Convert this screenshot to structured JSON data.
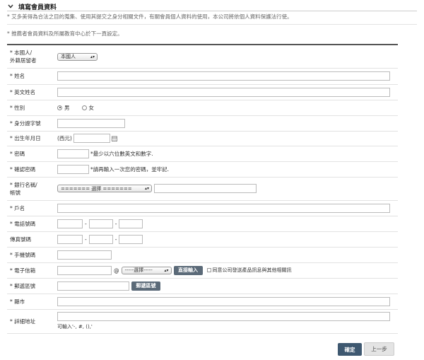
{
  "section": {
    "title": "填寫會員資料",
    "note1": "* 艾多美得為合法之目的蒐集、使用其提交之身分相關文件，有關會員個人資料的使用，本公司將依個人資料保護法行使。",
    "note2": "* 推薦者會員資料及所屬教育中心於下一頁設定。"
  },
  "form": {
    "resident": {
      "label_line1": "* 本國人/",
      "label_line2": "外籍居留者",
      "selected": "本國人"
    },
    "name": {
      "label": "* 姓名"
    },
    "english_name": {
      "label": "* 英文姓名"
    },
    "gender": {
      "label": "* 性別",
      "male": "男",
      "female": "女"
    },
    "id_number": {
      "label": "* 身分證字號"
    },
    "birthday": {
      "label": "* 出生年月日",
      "prefix": "(西元)"
    },
    "password": {
      "label": "* 密碼",
      "hint": "*最少以六位數英文和數字."
    },
    "confirm_password": {
      "label": "* 確認密碼",
      "hint": "*請再輸入一次您的密碼，並牢記."
    },
    "bank": {
      "label_line1": "* 銀行名稱/",
      "label_line2": "帳號",
      "selected": "======= 選擇 ======="
    },
    "account_name": {
      "label": "* 戶名"
    },
    "phone": {
      "label": "* 電話號碼",
      "sep1": "-",
      "sep2": "-"
    },
    "fax": {
      "label": "傳真號碼",
      "sep1": "-",
      "sep2": "-"
    },
    "mobile": {
      "label": "* 手機號碼"
    },
    "email": {
      "label": "* 電子信箱",
      "at": "@",
      "domain_selected": "-----選擇-----",
      "direct_button": "直接輸入",
      "consent": "同意公司發送產品訊息與其他相關訊"
    },
    "postal": {
      "label": "* 郵遞區號",
      "button": "郵遞區號"
    },
    "city": {
      "label": "* 縣市"
    },
    "address": {
      "label": "* 詳細地址",
      "hint": "可輸入'-, #, (),'"
    }
  },
  "buttons": {
    "confirm": "確定",
    "back": "上一步"
  }
}
